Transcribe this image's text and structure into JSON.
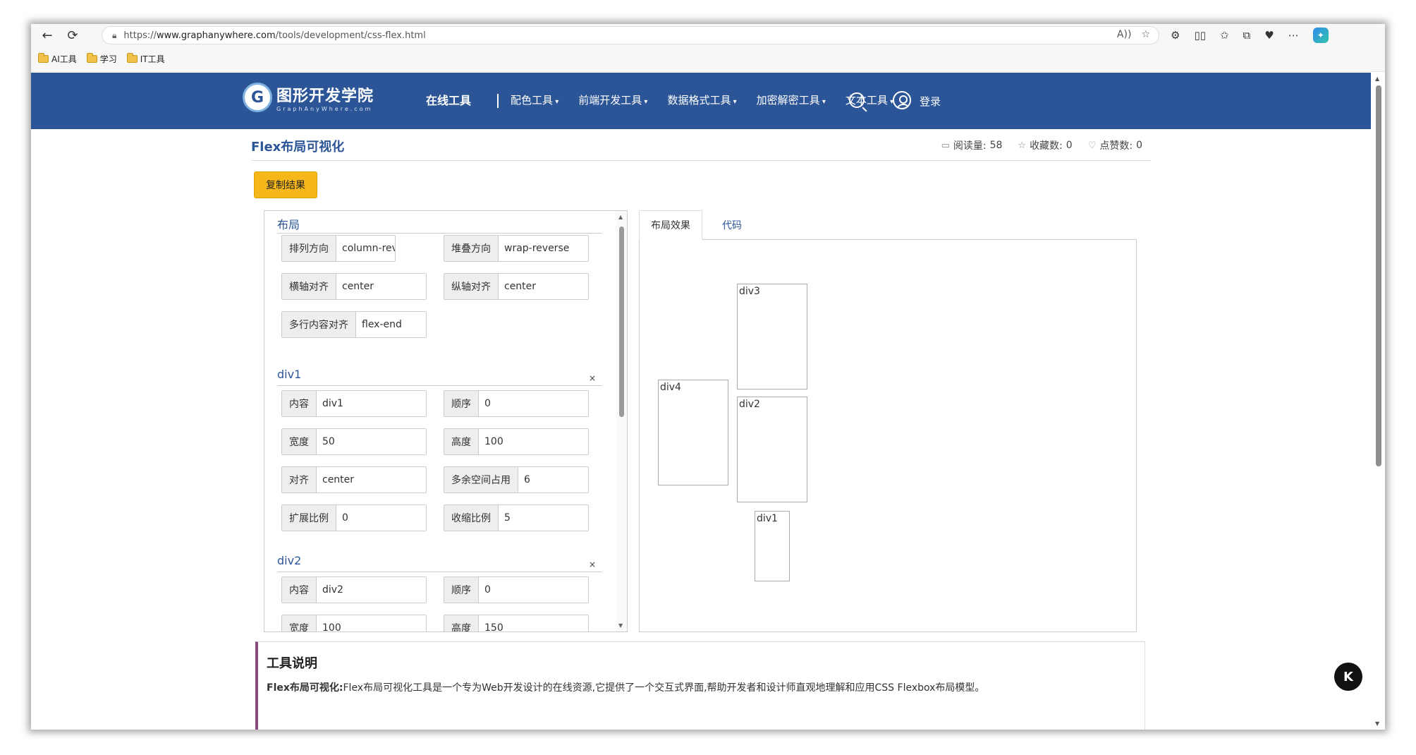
{
  "browser": {
    "url_prefix": "https://",
    "url_host": "www.graphanywhere.com",
    "url_path": "/tools/development/css-flex.html",
    "bookmarks": [
      {
        "label": "AI工具"
      },
      {
        "label": "学习"
      },
      {
        "label": "IT工具"
      }
    ]
  },
  "site": {
    "logo_cn": "图形开发学院",
    "logo_en": "GraphAnyWhere.com",
    "nav_main": "在线工具",
    "nav_items": [
      "配色工具",
      "前端开发工具",
      "数据格式工具",
      "加密解密工具",
      "文本工具"
    ],
    "login": "登录"
  },
  "page": {
    "title": "Flex布局可视化",
    "stats": {
      "reads_label": "阅读量:",
      "reads": "58",
      "favorites_label": "收藏数:",
      "favorites": "0",
      "likes_label": "点赞数:",
      "likes": "0"
    },
    "copy_button": "复制结果"
  },
  "settings": {
    "layout": {
      "heading": "布局",
      "direction_label": "排列方向",
      "direction": "column-reverse",
      "wrap_label": "堆叠方向",
      "wrap": "wrap-reverse",
      "justify_label": "横轴对齐",
      "justify": "center",
      "align_label": "纵轴对齐",
      "align": "center",
      "content_label": "多行内容对齐",
      "content": "flex-end"
    },
    "div1": {
      "heading": "div1",
      "close": "×",
      "content_label": "内容",
      "content": "div1",
      "order_label": "顺序",
      "order": "0",
      "width_label": "宽度",
      "width": "50",
      "height_label": "高度",
      "height": "100",
      "align_label": "对齐",
      "align": "center",
      "basis_label": "多余空间占用",
      "basis": "6",
      "grow_label": "扩展比例",
      "grow": "0",
      "shrink_label": "收缩比例",
      "shrink": "5"
    },
    "div2": {
      "heading": "div2",
      "close": "×",
      "content_label": "内容",
      "content": "div2",
      "order_label": "顺序",
      "order": "0",
      "width_label": "宽度",
      "width": "100",
      "height_label": "高度",
      "height": "150"
    }
  },
  "preview": {
    "tab_layout": "布局效果",
    "tab_code": "代码",
    "boxes": [
      "div3",
      "div4",
      "div2",
      "div1"
    ]
  },
  "description": {
    "heading": "工具说明",
    "lead": "Flex布局可视化:",
    "text": "Flex布局可视化工具是一个专为Web开发设计的在线资源,它提供了一个交互式界面,帮助开发者和设计师直观地理解和应用CSS Flexbox布局模型。"
  },
  "float_button": "K"
}
